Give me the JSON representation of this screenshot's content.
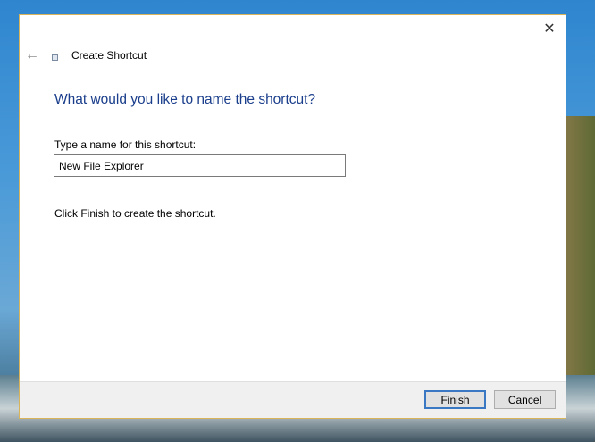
{
  "window": {
    "title": "Create Shortcut",
    "close_label": "✕",
    "back_label": "🡐"
  },
  "heading": "What would you like to name the shortcut?",
  "name_label": "Type a name for this shortcut:",
  "name_value": "New File Explorer",
  "hint": "Click Finish to create the shortcut.",
  "buttons": {
    "finish": "Finish",
    "cancel": "Cancel"
  }
}
